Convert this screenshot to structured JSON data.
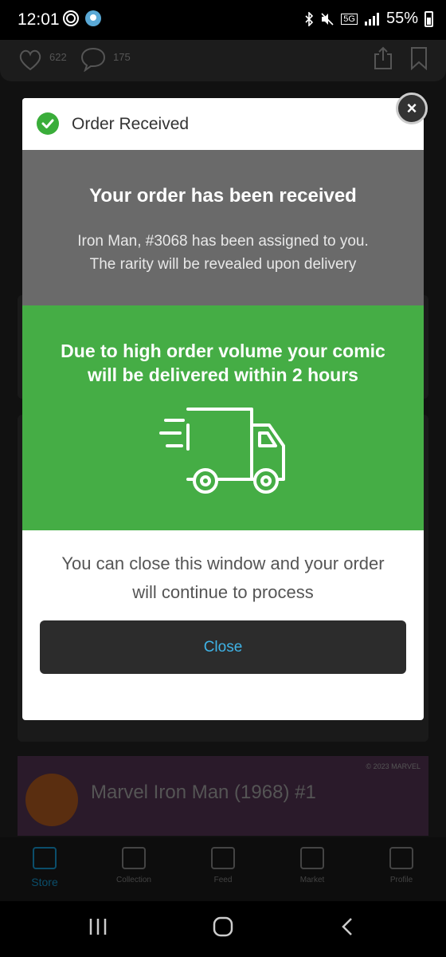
{
  "status_bar": {
    "time": "12:01",
    "network": "5G",
    "battery": "55%"
  },
  "background": {
    "likes": "622",
    "comments": "175",
    "promo_title": "Marvel Iron Man (1968) #1",
    "promo_copyright": "© 2023 MARVEL",
    "nav": [
      "Store",
      "Collection",
      "Feed",
      "Market",
      "Profile"
    ]
  },
  "modal": {
    "header_title": "Order Received",
    "heading": "Your order has been received",
    "message_line1": "Iron Man, #3068 has been assigned to you.",
    "message_line2": "The rarity will be revealed upon delivery",
    "delivery_line1": "Due to high order volume your comic",
    "delivery_line2": "will be delivered within 2 hours",
    "footer_line1": "You can close this window and your order",
    "footer_line2": "will continue to process",
    "close_label": "Close",
    "accent_color": "#45ad45",
    "link_color": "#3fb3e6"
  }
}
